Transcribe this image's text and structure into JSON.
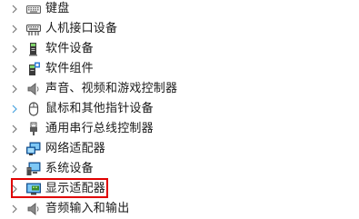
{
  "device_tree": {
    "items": [
      {
        "label": "键盘",
        "icon": "keyboard-icon",
        "expander_color": "#7a7a7a"
      },
      {
        "label": "人机接口设备",
        "icon": "hid-icon",
        "expander_color": "#7a7a7a"
      },
      {
        "label": "软件设备",
        "icon": "software-device-icon",
        "expander_color": "#7a7a7a"
      },
      {
        "label": "软件组件",
        "icon": "software-component-icon",
        "expander_color": "#7a7a7a"
      },
      {
        "label": "声音、视频和游戏控制器",
        "icon": "speaker-icon",
        "expander_color": "#7a7a7a"
      },
      {
        "label": "鼠标和其他指针设备",
        "icon": "mouse-icon",
        "expander_color": "#4aa3df"
      },
      {
        "label": "通用串行总线控制器",
        "icon": "usb-icon",
        "expander_color": "#7a7a7a"
      },
      {
        "label": "网络适配器",
        "icon": "network-adapter-icon",
        "expander_color": "#7a7a7a"
      },
      {
        "label": "系统设备",
        "icon": "system-device-icon",
        "expander_color": "#7a7a7a"
      },
      {
        "label": "显示适配器",
        "icon": "display-adapter-icon",
        "expander_color": "#7a7a7a"
      },
      {
        "label": "音频输入和输出",
        "icon": "audio-io-icon",
        "expander_color": "#7a7a7a"
      }
    ],
    "highlighted_item": "显示适配器",
    "highlight_color": "#e00000"
  }
}
